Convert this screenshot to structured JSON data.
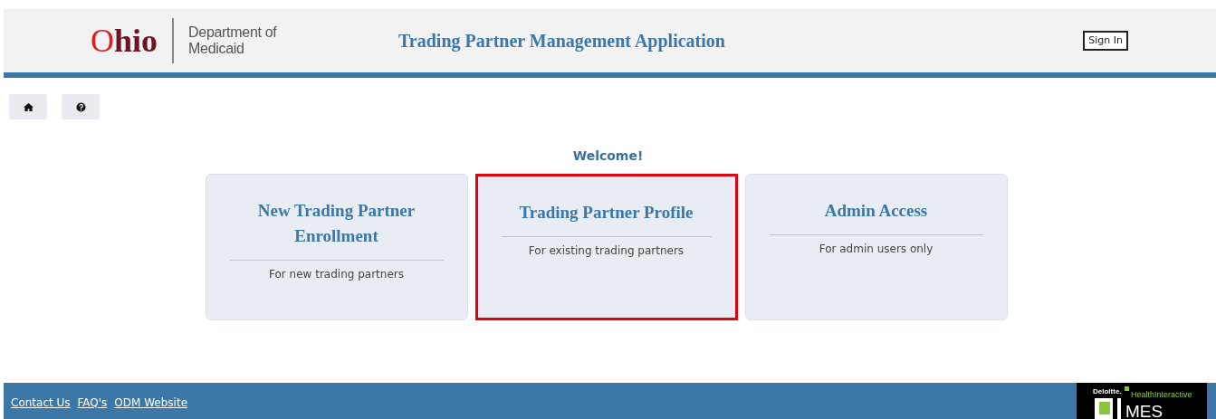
{
  "header": {
    "logo_word": "Ohio",
    "logo_department": "Department of",
    "logo_agency": "Medicaid",
    "title": "Trading Partner Management Application",
    "sign_in": "Sign In"
  },
  "toolbar": [
    {
      "kind": "home"
    },
    {
      "kind": "help"
    }
  ],
  "welcome": "Welcome!",
  "cards": [
    {
      "title": "New Trading Partner Enrollment",
      "subtitle": "For new trading partners",
      "selected": false
    },
    {
      "title": "Trading Partner Profile",
      "subtitle": "For existing trading partners",
      "selected": true
    },
    {
      "title": "Admin Access",
      "subtitle": "For admin users only",
      "selected": false
    }
  ],
  "footer": {
    "links": [
      "Contact Us",
      "FAQ's",
      "ODM Website"
    ],
    "partner_logo": {
      "brand": "Deloitte.",
      "product": "HealthInteractive",
      "system": "MES"
    }
  }
}
